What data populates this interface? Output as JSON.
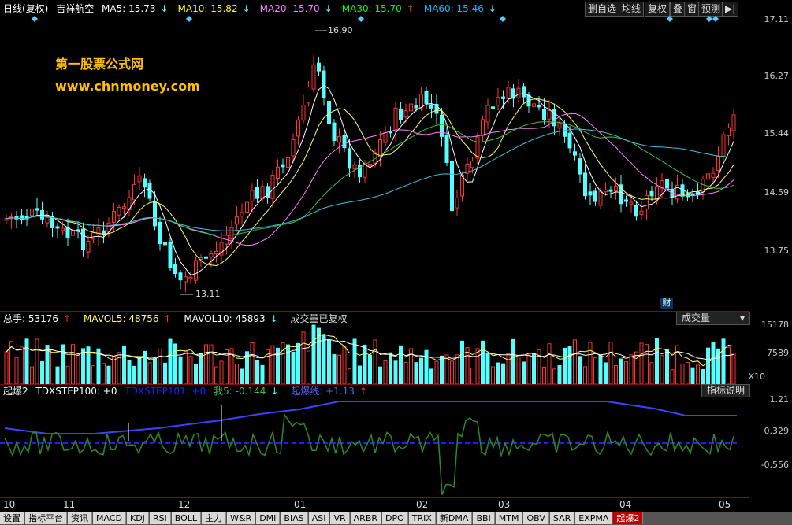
{
  "header": {
    "period": "日线(复权)",
    "stock": "吉祥航空",
    "ma": [
      {
        "label": "MA5: 15.73",
        "arrow": "↓",
        "color": "#ffffff"
      },
      {
        "label": "MA10: 15.82",
        "arrow": "↓",
        "color": "#ffff00"
      },
      {
        "label": "MA20: 15.70",
        "arrow": "↓",
        "color": "#ff80ff"
      },
      {
        "label": "MA30: 15.70",
        "arrow": "↑",
        "color": "#00ff00"
      },
      {
        "label": "MA60: 15.46",
        "arrow": "↓",
        "color": "#00c0ff"
      }
    ]
  },
  "toolbar": {
    "delete_self_select": "删自选",
    "ma_line": "均线",
    "adjust": "复权",
    "overlay": "叠",
    "window": "窗",
    "forecast": "预测",
    "arrow": "▶|"
  },
  "watermark": {
    "site_name": "第一股票公式网",
    "site_url": "www.chnmoney.com"
  },
  "price_axis": [
    "17.11",
    "16.27",
    "15.44",
    "14.59",
    "13.75"
  ],
  "price_annotations": {
    "high": "16.90",
    "low": "13.11"
  },
  "finance_marker": "财",
  "volume_header": {
    "total": "总手: 53176",
    "total_arrow": "↑",
    "mavol5": "MAVOL5: 48756",
    "mavol5_arrow": "↑",
    "mavol10": "MAVOL10: 45893",
    "mavol10_arrow": "↓",
    "note": "成交量已复权",
    "selector": "成交量"
  },
  "volume_axis": [
    "15178",
    "7589",
    "X10"
  ],
  "indicator_header": {
    "name": "起爆2",
    "tdxstep100": "TDXSTEP100: +0",
    "tdxstep101": "TDXSTEP101: +0",
    "me5": "我5: -0.144",
    "me5_arrow": "↓",
    "line": "起爆线: +1.13",
    "line_arrow": "↑",
    "explain": "指标说明"
  },
  "indicator_axis": [
    "1.21",
    "0.329",
    "-0.556"
  ],
  "time_axis": [
    "10",
    "11",
    "12",
    "01",
    "02",
    "03",
    "04",
    "05"
  ],
  "bottom_tabs": [
    "设置",
    "指标平台",
    "资讯",
    "MACD",
    "KDJ",
    "RSI",
    "BOLL",
    "主力",
    "W&R",
    "DMI",
    "BIAS",
    "ASI",
    "VR",
    "ARBR",
    "DPO",
    "TRIX",
    "新DMA",
    "BBI",
    "MTM",
    "OBV",
    "SAR",
    "EXPMA",
    "起爆2"
  ],
  "colors": {
    "up": "#ff3232",
    "down": "#54ffff",
    "frame": "#7a1010",
    "blue_line": "#4040ff",
    "green_line": "#2a8a2a"
  }
}
